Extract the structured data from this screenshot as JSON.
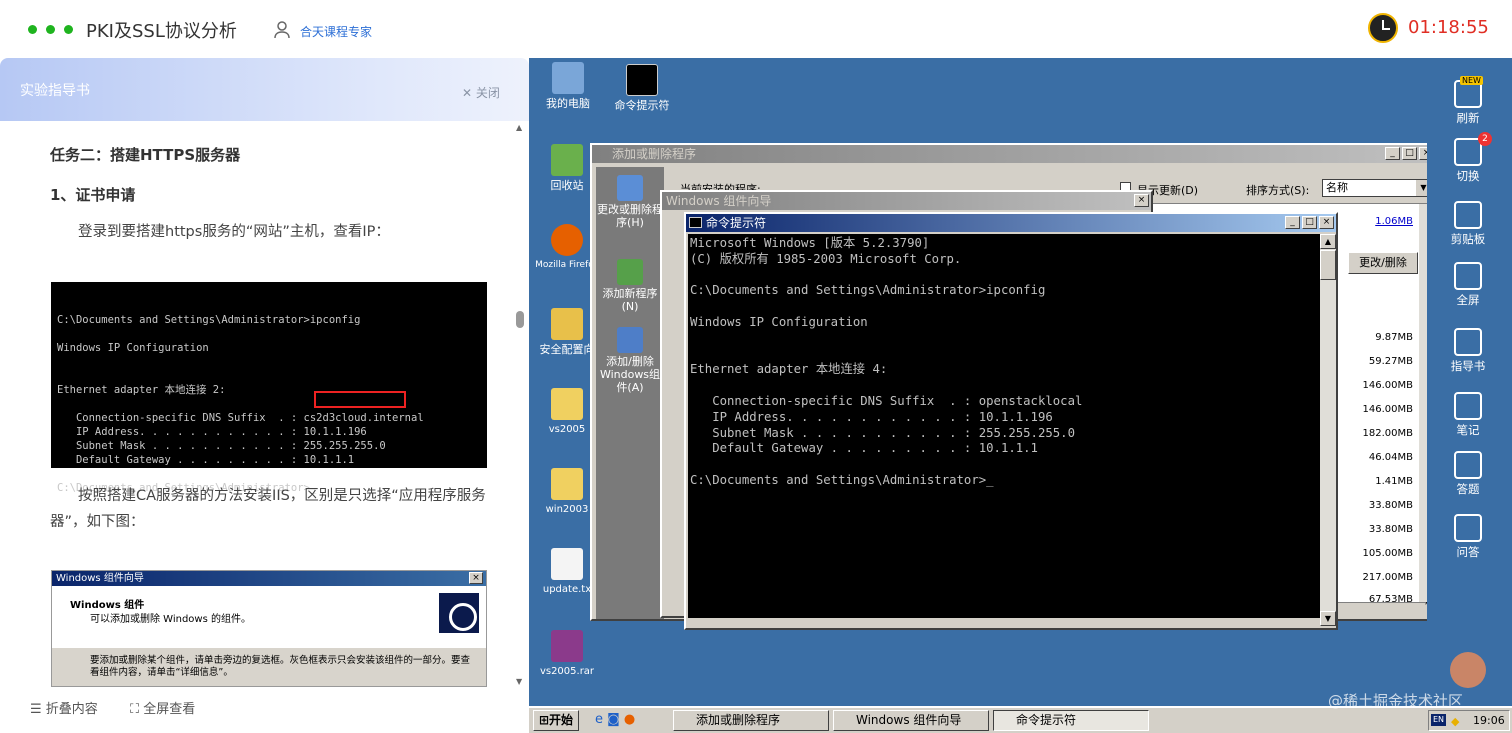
{
  "header": {
    "title": "PKI及SSL协议分析",
    "expert": "合天课程专家",
    "timer": "01:18:55"
  },
  "guide": {
    "title": "实验指导书",
    "close": "关闭",
    "task": "任务二：搭建HTTPS服务器",
    "step": "1、证书申请",
    "para1": "登录到要搭建https服务的“网站”主机，查看IP：",
    "shot1_lines": "C:\\Documents and Settings\\Administrator>ipconfig\n\nWindows IP Configuration\n\n\nEthernet adapter 本地连接 2:\n\n   Connection-specific DNS Suffix  . : cs2d3cloud.internal\n   IP Address. . . . . . . . . . . . : 10.1.1.196\n   Subnet Mask . . . . . . . . . . . : 255.255.255.0\n   Default Gateway . . . . . . . . . : 10.1.1.1\n\nC:\\Documents and Settings\\Administrator>_",
    "para2": "按照搭建CA服务器的方法安装IIS，区别是只选择“应用程序服务器”，如下图：",
    "wizard_title": "Windows 组件向导",
    "wizard_heading": "Windows 组件",
    "wizard_sub": "可以添加或删除 Windows 的组件。",
    "wizard_text": "要添加或删除某个组件，请单击旁边的复选框。灰色框表示只会安装该组件的一部分。要查看组件内容，请单击“详细信息”。",
    "collapse": "折叠内容",
    "fullscreen": "全屏查看"
  },
  "desktop": {
    "icons": [
      "我的电脑",
      "命令提示符",
      "回收站",
      "Mozilla Firefox",
      "安全配置向",
      "vs2005",
      "win2003",
      "update.tx",
      "vs2005.rar"
    ]
  },
  "arp": {
    "title": "添加或删除程序",
    "sidebar": [
      "更改或删除程序(H)",
      "添加新程序(N)",
      "添加/删除Windows组件(A)"
    ],
    "current": "当前安装的程序:",
    "show_updates": "显示更新(D)",
    "sort_label": "排序方式(S):",
    "sort_value": "名称",
    "change_remove": "更改/删除",
    "sizes": [
      "1.06MB",
      "9.87MB",
      "59.27MB",
      "146.00MB",
      "146.00MB",
      "182.00MB",
      "46.04MB",
      "1.41MB",
      "33.80MB",
      "33.80MB",
      "105.00MB",
      "217.00MB",
      "67.53MB"
    ],
    "xiao": "小"
  },
  "wizard_win": {
    "title": "Windows 组件向导"
  },
  "cmd": {
    "title": "命令提示符",
    "text": "Microsoft Windows [版本 5.2.3790]\n(C) 版权所有 1985-2003 Microsoft Corp.\n\nC:\\Documents and Settings\\Administrator>ipconfig\n\nWindows IP Configuration\n\n\nEthernet adapter 本地连接 4:\n\n   Connection-specific DNS Suffix  . : openstacklocal\n   IP Address. . . . . . . . . . . . : 10.1.1.196\n   Subnet Mask . . . . . . . . . . . : 255.255.255.0\n   Default Gateway . . . . . . . . . : 10.1.1.1\n\nC:\\Documents and Settings\\Administrator>_"
  },
  "toolbar": {
    "new_badge": "NEW",
    "refresh": "刷新",
    "switch": "切换",
    "switch_badge": "2",
    "clipboard": "剪贴板",
    "fullscreen": "全屏",
    "guide": "指导书",
    "notes": "笔记",
    "answer": "答题",
    "qa": "问答"
  },
  "taskbar": {
    "start": "开始",
    "tasks": [
      "添加或删除程序",
      "Windows 组件向导",
      "命令提示符"
    ],
    "tray_lang": "EN",
    "time": "19:06"
  },
  "watermark": "@稀土掘金技术社区"
}
